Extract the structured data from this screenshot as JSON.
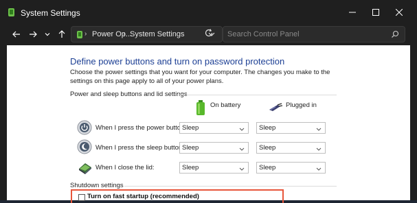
{
  "window": {
    "title": "System Settings",
    "app_icon": "control-panel-icon"
  },
  "nav": {
    "breadcrumb_1": "Power Op...",
    "separator": "›",
    "breadcrumb_2": "System Settings",
    "search_placeholder": "Search Control Panel",
    "icons": [
      "back-arrow-icon",
      "forward-arrow-icon",
      "recent-dropdown-icon",
      "up-arrow-icon",
      "refresh-icon",
      "search-icon"
    ]
  },
  "main": {
    "heading": "Define power buttons and turn on password protection",
    "description": "Choose the power settings that you want for your computer. The changes you make to the settings on this page apply to all of your power plans.",
    "section_power": "Power and sleep buttons and lid settings",
    "col_battery": "On battery",
    "col_plugged": "Plugged in",
    "rows": [
      {
        "label": "When I press the power button:",
        "battery": "Sleep",
        "plugged": "Sleep",
        "icon": "power-button-icon"
      },
      {
        "label": "When I press the sleep button:",
        "battery": "Sleep",
        "plugged": "Sleep",
        "icon": "sleep-button-icon"
      },
      {
        "label": "When I close the lid:",
        "battery": "Sleep",
        "plugged": "Sleep",
        "icon": "laptop-lid-icon"
      }
    ],
    "section_shutdown": "Shutdown settings",
    "fast_startup_label": "Turn on fast startup (recommended)",
    "fast_startup_checked": false
  },
  "colors": {
    "heading": "#1c3f94",
    "highlight_border": "#e8553a",
    "titlebar_bg": "#1f1f1f"
  }
}
